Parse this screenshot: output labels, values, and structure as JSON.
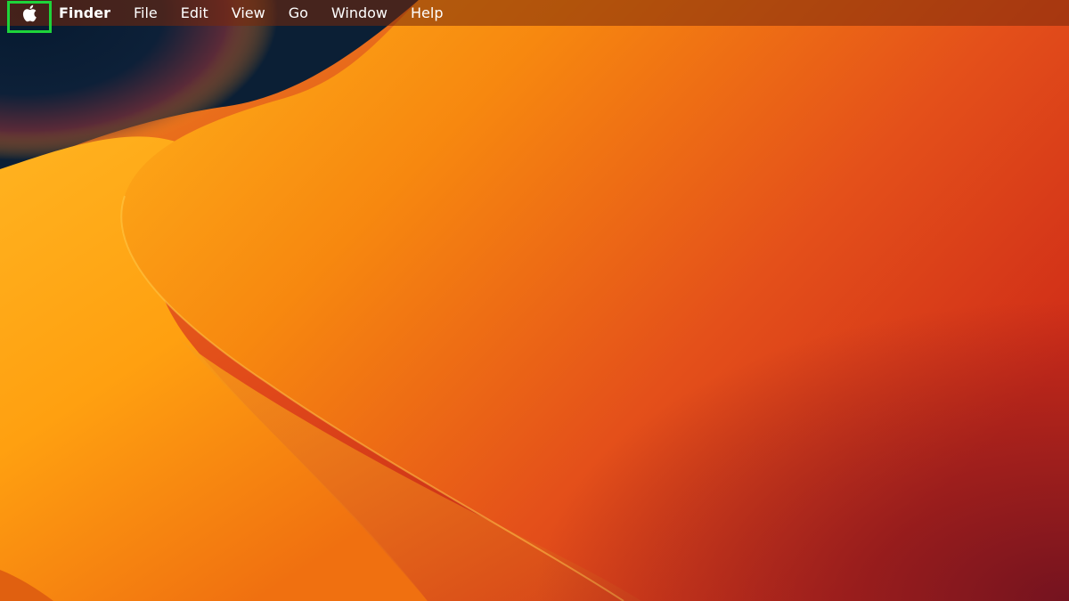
{
  "menubar": {
    "apple_menu_icon": "apple-logo-icon",
    "app_name": "Finder",
    "items": [
      {
        "label": "File"
      },
      {
        "label": "Edit"
      },
      {
        "label": "View"
      },
      {
        "label": "Go"
      },
      {
        "label": "Window"
      },
      {
        "label": "Help"
      }
    ],
    "highlight_color": "#1ed43a"
  },
  "wallpaper": {
    "name": "macOS Ventura",
    "colors": {
      "navy": "#0b1f35",
      "yellow": "#ffb21a",
      "orange": "#f57a12",
      "red": "#d23417",
      "dark_red": "#7a1620"
    }
  }
}
